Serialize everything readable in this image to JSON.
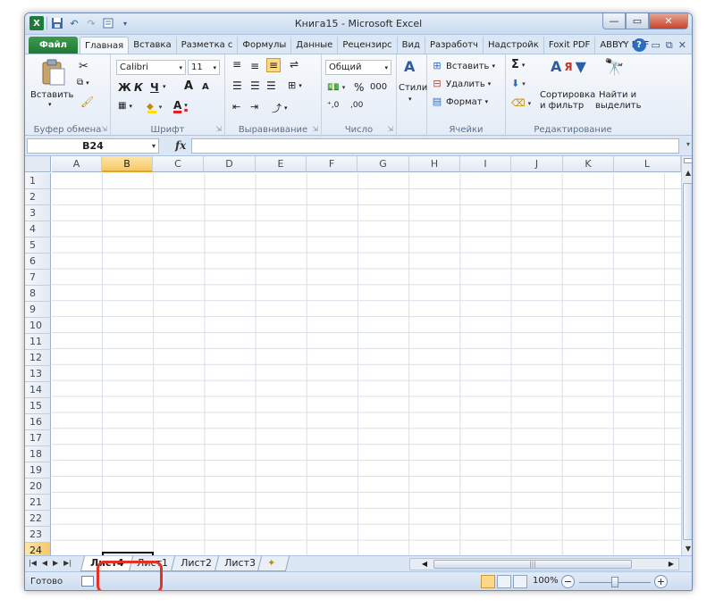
{
  "window": {
    "title": "Книга15  -  Microsoft Excel",
    "qat": {
      "app_icon": "X"
    }
  },
  "tabs": [
    {
      "label": "Файл"
    },
    {
      "label": "Главная"
    },
    {
      "label": "Вставка"
    },
    {
      "label": "Разметка с"
    },
    {
      "label": "Формулы"
    },
    {
      "label": "Данные"
    },
    {
      "label": "Рецензирс"
    },
    {
      "label": "Вид"
    },
    {
      "label": "Разработч"
    },
    {
      "label": "Надстройк"
    },
    {
      "label": "Foxit PDF"
    },
    {
      "label": "ABBYY PDF"
    }
  ],
  "ribbon": {
    "clipboard": {
      "paste": "Вставить",
      "label": "Буфер обмена"
    },
    "font": {
      "name": "Calibri",
      "size": "11",
      "bold": "Ж",
      "italic": "К",
      "underline": "Ч",
      "grow": "A",
      "shrink": "A",
      "label": "Шрифт"
    },
    "alignment": {
      "label": "Выравнивание"
    },
    "number": {
      "format": "Общий",
      "percent": "%",
      "thousands": "000",
      "label": "Число"
    },
    "styles": {
      "button": "Стили"
    },
    "cells": {
      "insert": "Вставить",
      "delete": "Удалить",
      "format": "Формат",
      "label": "Ячейки"
    },
    "editing": {
      "sigma": "Σ",
      "sort": "Сортировка",
      "sort2": "и фильтр",
      "find": "Найти и",
      "find2": "выделить",
      "label": "Редактирование"
    }
  },
  "formula_bar": {
    "name_box": "B24",
    "fx": "fx",
    "value": ""
  },
  "grid": {
    "columns": [
      "A",
      "B",
      "C",
      "D",
      "E",
      "F",
      "G",
      "H",
      "I",
      "J",
      "K",
      "L"
    ],
    "selected_column": "B",
    "rows": [
      "1",
      "2",
      "3",
      "4",
      "5",
      "6",
      "7",
      "8",
      "9",
      "10",
      "11",
      "12",
      "13",
      "14",
      "15",
      "16",
      "17",
      "18",
      "19",
      "20",
      "21",
      "22",
      "23",
      "24"
    ],
    "selected_row": "24"
  },
  "sheets": [
    {
      "label": "Лист4",
      "active": true
    },
    {
      "label": "Лист1",
      "active": false
    },
    {
      "label": "Лист2",
      "active": false
    },
    {
      "label": "Лист3",
      "active": false
    }
  ],
  "status": {
    "ready": "Готово",
    "zoom": "100%",
    "zoom_minus": "−",
    "zoom_plus": "+"
  },
  "colors": {
    "file_tab": "#1f7a33",
    "selection": "#f7c866",
    "highlight": "#e53025"
  }
}
